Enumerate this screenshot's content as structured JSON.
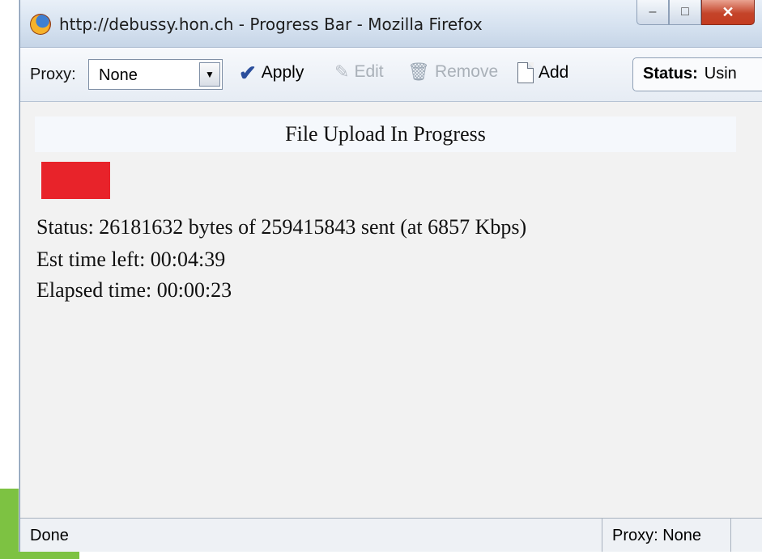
{
  "window": {
    "title": "http://debussy.hon.ch - Progress Bar - Mozilla Firefox",
    "min_glyph": "–",
    "max_glyph": "□",
    "close_glyph": "✕"
  },
  "toolbar": {
    "proxy_label": "Proxy:",
    "proxy_value": "None",
    "dropdown_glyph": "▼",
    "apply_label": "Apply",
    "edit_label": "Edit",
    "remove_label": "Remove",
    "add_label": "Add",
    "status_label": "Status:",
    "status_value": "Usin",
    "icons": {
      "apply": "check-icon",
      "edit": "pencil-icon",
      "remove": "trash-icon",
      "add": "page-icon"
    }
  },
  "page": {
    "heading": "File Upload In Progress",
    "progress_fraction": 0.1009,
    "progress_color": "#e8232a",
    "status_line": "Status: 26181632 bytes of 259415843 sent (at 6857 Kbps)",
    "est_time_line": "Est time left: 00:04:39",
    "elapsed_line": "Elapsed time: 00:00:23"
  },
  "statusbar": {
    "left": "Done",
    "proxy": "Proxy: None"
  },
  "colors": {
    "accent_green": "#7dc242"
  }
}
